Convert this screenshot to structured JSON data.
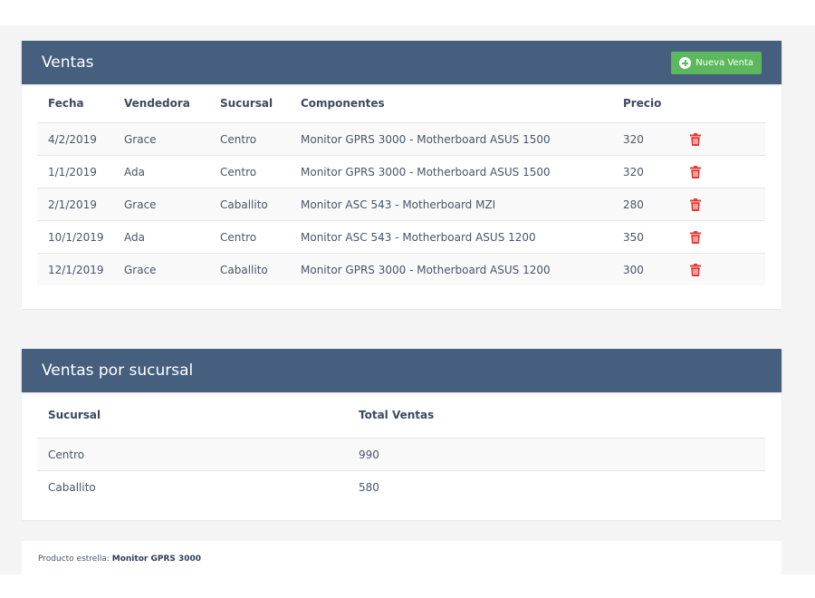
{
  "sales": {
    "title": "Ventas",
    "new_button_label": "Nueva Venta",
    "columns": [
      "Fecha",
      "Vendedora",
      "Sucursal",
      "Componentes",
      "Precio"
    ],
    "rows": [
      {
        "fecha": "4/2/2019",
        "vendedora": "Grace",
        "sucursal": "Centro",
        "componentes": "Monitor GPRS 3000 - Motherboard ASUS 1500",
        "precio": "320"
      },
      {
        "fecha": "1/1/2019",
        "vendedora": "Ada",
        "sucursal": "Centro",
        "componentes": "Monitor GPRS 3000 - Motherboard ASUS 1500",
        "precio": "320"
      },
      {
        "fecha": "2/1/2019",
        "vendedora": "Grace",
        "sucursal": "Caballito",
        "componentes": "Monitor ASC 543 - Motherboard MZI",
        "precio": "280"
      },
      {
        "fecha": "10/1/2019",
        "vendedora": "Ada",
        "sucursal": "Centro",
        "componentes": "Monitor ASC 543 - Motherboard ASUS 1200",
        "precio": "350"
      },
      {
        "fecha": "12/1/2019",
        "vendedora": "Grace",
        "sucursal": "Caballito",
        "componentes": "Monitor GPRS 3000 - Motherboard ASUS 1200",
        "precio": "300"
      }
    ]
  },
  "branches": {
    "title": "Ventas por sucursal",
    "columns": [
      "Sucursal",
      "Total Ventas"
    ],
    "rows": [
      {
        "sucursal": "Centro",
        "total": "990"
      },
      {
        "sucursal": "Caballito",
        "total": "580"
      }
    ]
  },
  "footer": {
    "label": "Producto estrella:",
    "value": "Monitor GPRS 3000"
  },
  "colors": {
    "header": "#465f7e",
    "button": "#5cb85c",
    "delete": "#e53935",
    "background": "#f4f4f4"
  },
  "icons": {
    "new_button": "plus-circle-icon",
    "delete": "trash-icon"
  }
}
